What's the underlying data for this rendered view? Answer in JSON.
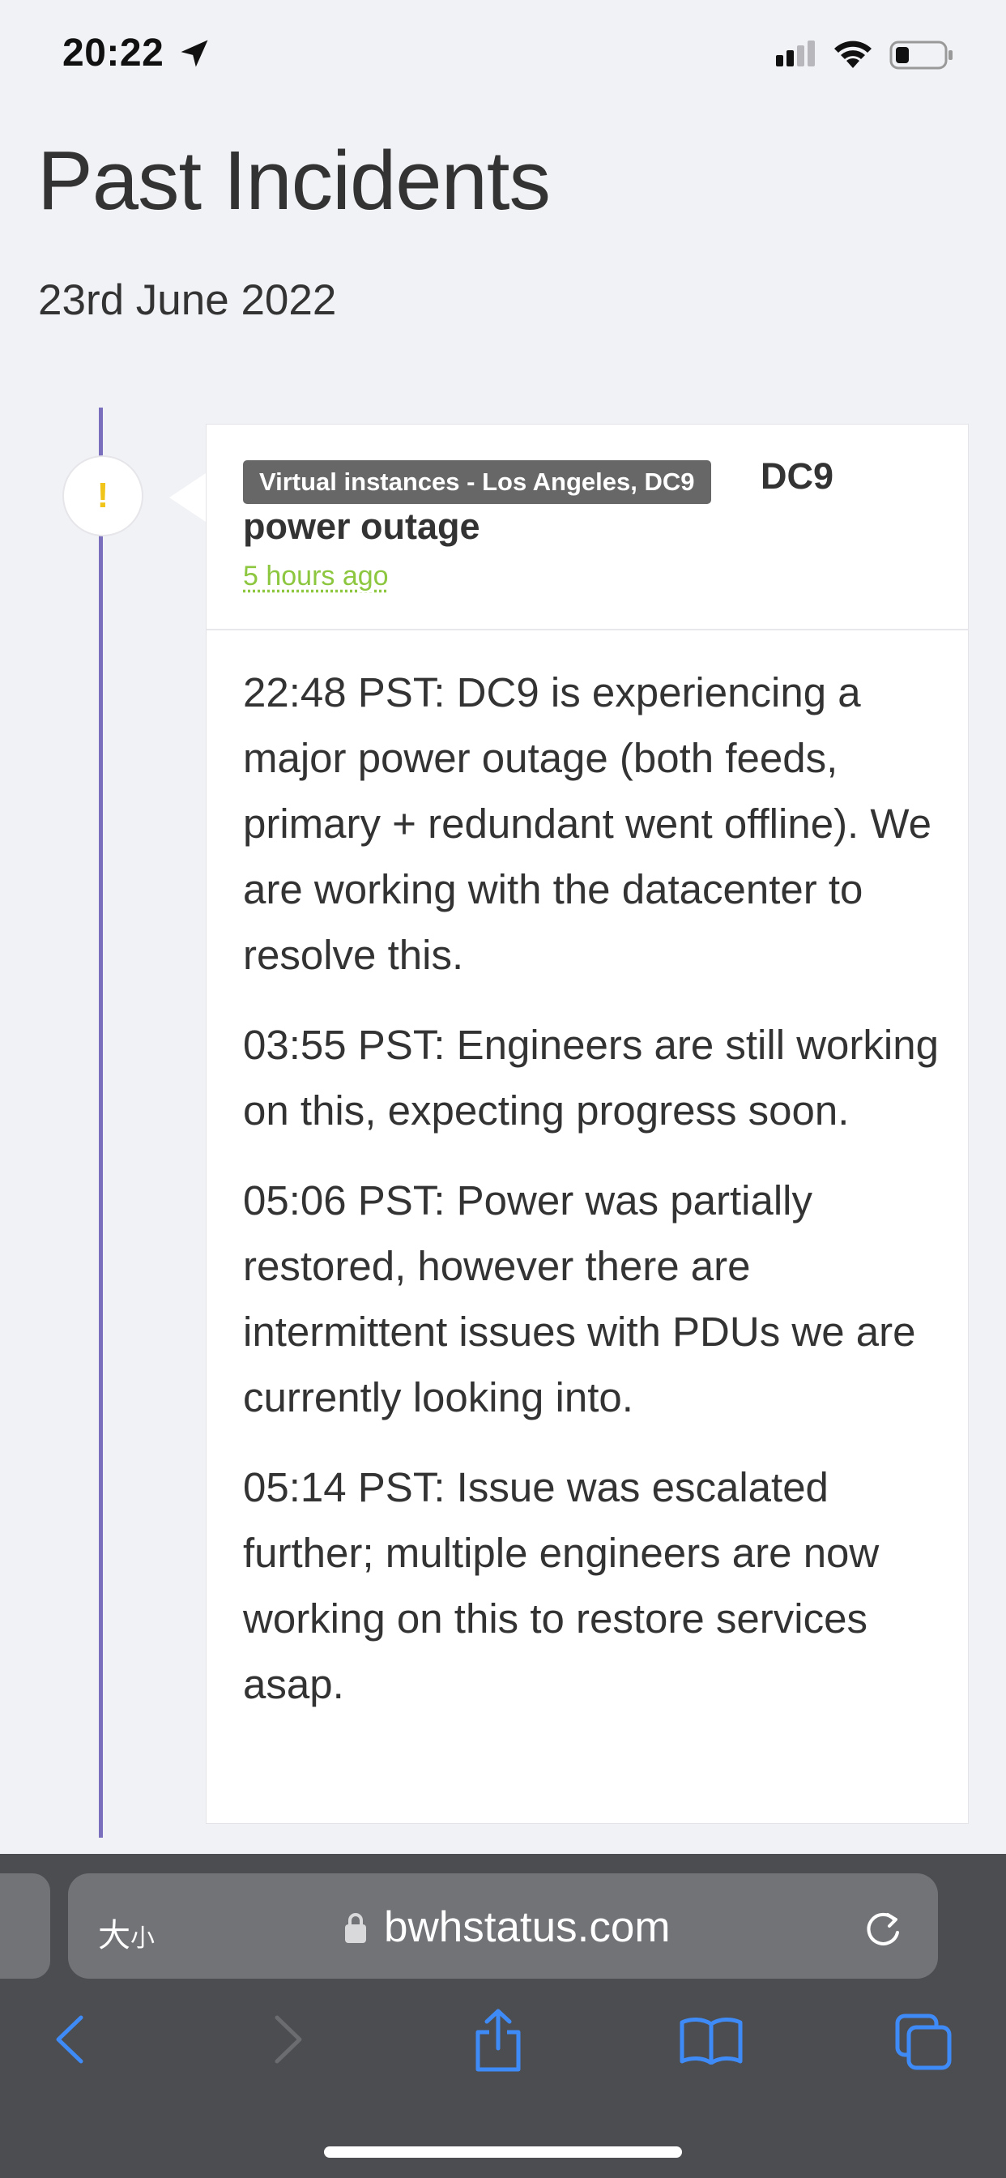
{
  "status_bar": {
    "time": "20:22"
  },
  "page": {
    "title": "Past Incidents",
    "date": "23rd June 2022"
  },
  "incident": {
    "component": "Virtual instances - Los Angeles, DC9",
    "title_part1": "DC9",
    "title_part2": "power outage",
    "time_ago": "5 hours ago",
    "status_icon": "exclamation-icon",
    "updates": [
      "22:48 PST: DC9 is experiencing a major power outage (both feeds, primary + redundant went offline). We are working with the datacenter to resolve this.",
      "03:55 PST: Engineers are still working on this, expecting progress soon.",
      "05:06 PST: Power was partially restored, however there are intermittent issues with PDUs we are currently looking into.",
      "05:14 PST: Issue was escalated further; multiple engineers are now working on this to restore services asap."
    ]
  },
  "browser": {
    "text_size_label_big": "大",
    "text_size_label_small": "小",
    "url": "bwhstatus.com"
  },
  "colors": {
    "timeline": "#7a6fbd",
    "warning": "#f0c419",
    "timestamp_link": "#8dc63f",
    "ios_blue": "#3e8bf7",
    "browser_bg": "#4c4d51"
  }
}
